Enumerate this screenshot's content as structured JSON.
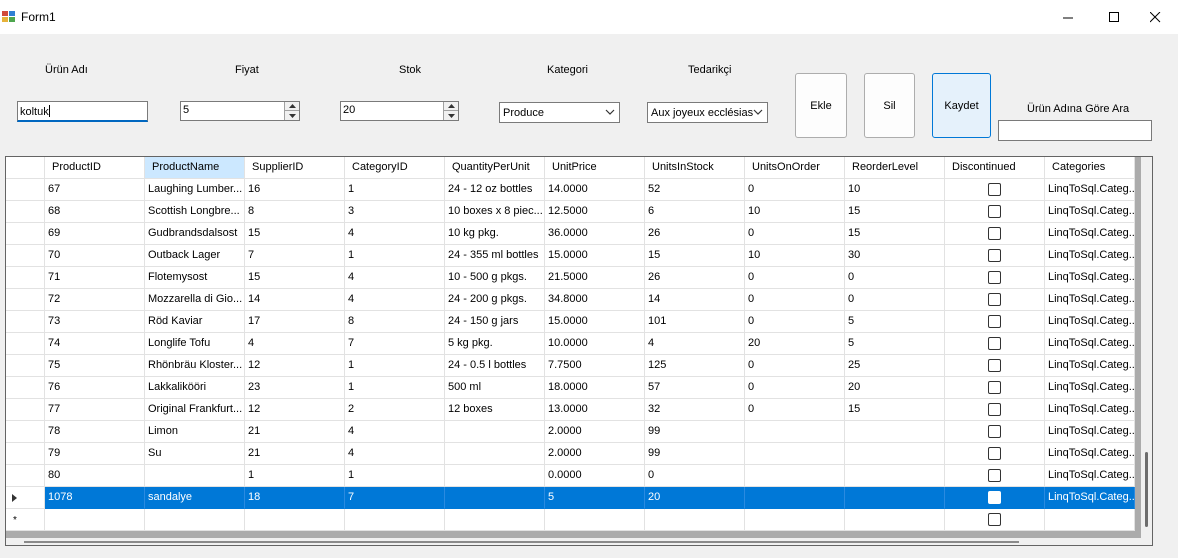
{
  "window": {
    "title": "Form1"
  },
  "form": {
    "product_name_label": "Ürün Adı",
    "price_label": "Fiyat",
    "stock_label": "Stok",
    "category_label": "Kategori",
    "supplier_label": "Tedarikçi",
    "product_name_value": "koltuk",
    "price_value": "5",
    "stock_value": "20",
    "category_selected": "Produce",
    "supplier_selected": "Aux joyeux ecclésias",
    "add_button": "Ekle",
    "delete_button": "Sil",
    "save_button": "Kaydet",
    "search_label": "Ürün Adına Göre Ara",
    "search_value": ""
  },
  "grid": {
    "columns": [
      "ProductID",
      "ProductName",
      "SupplierID",
      "CategoryID",
      "QuantityPerUnit",
      "UnitPrice",
      "UnitsInStock",
      "UnitsOnOrder",
      "ReorderLevel",
      "Discontinued",
      "Categories"
    ],
    "selected_column": "ProductName",
    "rows": [
      [
        "67",
        "Laughing Lumber...",
        "16",
        "1",
        "24 - 12 oz bottles",
        "14.0000",
        "52",
        "0",
        "10",
        "",
        "LinqToSql.Categ..."
      ],
      [
        "68",
        "Scottish Longbre...",
        "8",
        "3",
        "10 boxes x 8 piec...",
        "12.5000",
        "6",
        "10",
        "15",
        "",
        "LinqToSql.Categ..."
      ],
      [
        "69",
        "Gudbrandsdalsost",
        "15",
        "4",
        "10 kg pkg.",
        "36.0000",
        "26",
        "0",
        "15",
        "",
        "LinqToSql.Categ..."
      ],
      [
        "70",
        "Outback Lager",
        "7",
        "1",
        "24 - 355 ml bottles",
        "15.0000",
        "15",
        "10",
        "30",
        "",
        "LinqToSql.Categ..."
      ],
      [
        "71",
        "Flotemysost",
        "15",
        "4",
        "10 - 500 g pkgs.",
        "21.5000",
        "26",
        "0",
        "0",
        "",
        "LinqToSql.Categ..."
      ],
      [
        "72",
        "Mozzarella di Gio...",
        "14",
        "4",
        "24 - 200 g pkgs.",
        "34.8000",
        "14",
        "0",
        "0",
        "",
        "LinqToSql.Categ..."
      ],
      [
        "73",
        "Röd Kaviar",
        "17",
        "8",
        "24 - 150 g jars",
        "15.0000",
        "101",
        "0",
        "5",
        "",
        "LinqToSql.Categ..."
      ],
      [
        "74",
        "Longlife Tofu",
        "4",
        "7",
        "5 kg pkg.",
        "10.0000",
        "4",
        "20",
        "5",
        "",
        "LinqToSql.Categ..."
      ],
      [
        "75",
        "Rhönbräu Kloster...",
        "12",
        "1",
        "24 - 0.5 l bottles",
        "7.7500",
        "125",
        "0",
        "25",
        "",
        "LinqToSql.Categ..."
      ],
      [
        "76",
        "Lakkalikööri",
        "23",
        "1",
        "500 ml",
        "18.0000",
        "57",
        "0",
        "20",
        "",
        "LinqToSql.Categ..."
      ],
      [
        "77",
        "Original Frankfurt...",
        "12",
        "2",
        "12 boxes",
        "13.0000",
        "32",
        "0",
        "15",
        "",
        "LinqToSql.Categ..."
      ],
      [
        "78",
        "Limon",
        "21",
        "4",
        "",
        "2.0000",
        "99",
        "",
        "",
        "",
        "LinqToSql.Categ..."
      ],
      [
        "79",
        "Su",
        "21",
        "4",
        "",
        "2.0000",
        "99",
        "",
        "",
        "",
        "LinqToSql.Categ..."
      ],
      [
        "80",
        "",
        "1",
        "1",
        "",
        "0.0000",
        "0",
        "",
        "",
        "",
        "LinqToSql.Categ..."
      ],
      [
        "1078",
        "sandalye",
        "18",
        "7",
        "",
        "5",
        "20",
        "",
        "",
        "",
        "LinqToSql.Categ..."
      ]
    ],
    "selected_row_index": 14,
    "new_row_marker": "*"
  }
}
